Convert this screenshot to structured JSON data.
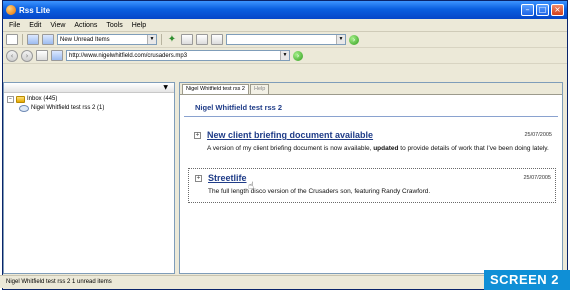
{
  "window": {
    "title": "Rss Lite"
  },
  "menu": [
    "File",
    "Edit",
    "View",
    "Actions",
    "Tools",
    "Help"
  ],
  "toolbar": {
    "view_selector": "New Unread Items"
  },
  "address": {
    "url": "http://www.nigelwhitfield.com/crusaders.mp3"
  },
  "tree": {
    "inbox": "Inbox (445)",
    "feed": "Nigel Whitfield test rss 2 (1)"
  },
  "tabs": [
    {
      "label": "Nigel Whitfield test rss 2"
    },
    {
      "label": "Help"
    }
  ],
  "feed": {
    "title": "Nigel Whitfield test rss 2",
    "items": [
      {
        "title": "New client briefing document available",
        "date": "25/07/2005",
        "body_pre": "A version of my client briefing document is now available, ",
        "body_bold": "updated",
        "body_post": " to provide details of work that I've been doing lately."
      },
      {
        "title": "Streetlife",
        "date": "25/07/2005",
        "body": "The full length disco version of the Crusaders son, featuring Randy Crawford."
      }
    ]
  },
  "status": {
    "text": "Nigel Whitfield test rss 2 1 unread items"
  },
  "caption": {
    "label": "SCREEN 2"
  },
  "colors": {
    "title_bar": "#0a5fe0",
    "link": "#1f3c88",
    "caption_bg": "#0f8fd6"
  }
}
